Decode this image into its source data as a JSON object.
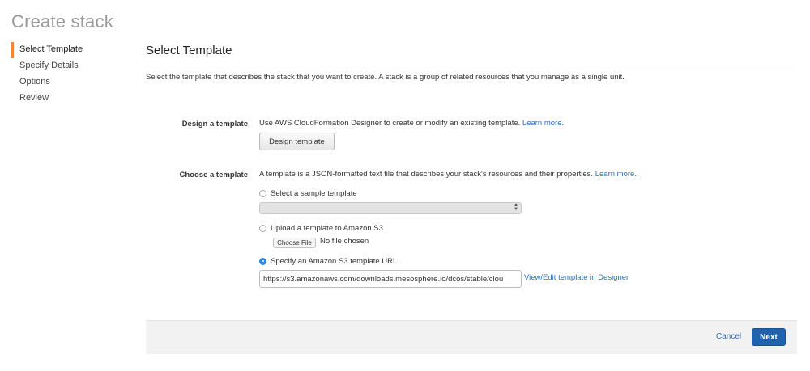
{
  "page": {
    "title": "Create stack"
  },
  "wizard": {
    "steps": [
      {
        "label": "Select Template"
      },
      {
        "label": "Specify Details"
      },
      {
        "label": "Options"
      },
      {
        "label": "Review"
      }
    ],
    "active_step": "Select Template"
  },
  "section": {
    "title": "Select Template",
    "description": "Select the template that describes the stack that you want to create. A stack is a group of related resources that you manage as a single unit."
  },
  "design": {
    "label": "Design a template",
    "text": "Use AWS CloudFormation Designer to create or modify an existing template.",
    "learn_more": "Learn more.",
    "button_label": "Design template"
  },
  "choose": {
    "label": "Choose a template",
    "text": "A template is a JSON-formatted text file that describes your stack's resources and their properties.",
    "learn_more": "Learn more.",
    "options": {
      "sample": {
        "label": "Select a sample template",
        "checked": false
      },
      "upload": {
        "label": "Upload a template to Amazon S3",
        "checked": false
      },
      "url": {
        "label": "Specify an Amazon S3 template URL",
        "checked": true
      }
    },
    "sample_select_value": "",
    "file_button_label": "Choose File",
    "file_status": "No file chosen",
    "url_value": "https://s3.amazonaws.com/downloads.mesosphere.io/dcos/stable/clou",
    "view_edit_link": "View/Edit template in Designer"
  },
  "footer": {
    "cancel_label": "Cancel",
    "next_label": "Next"
  },
  "colors": {
    "accent": "#f58536",
    "link": "#2a6ebb",
    "primary_button": "#1f62b0",
    "radio_checked": "#2a88e2"
  }
}
